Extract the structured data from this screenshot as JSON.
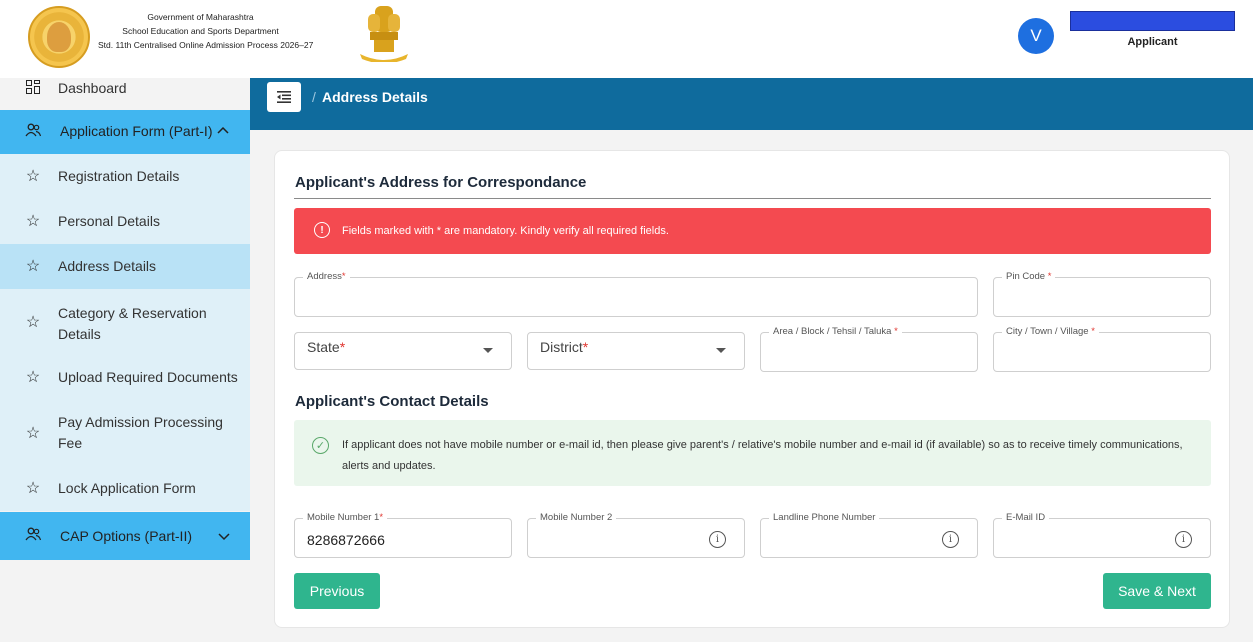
{
  "header": {
    "gov_line1": "Government of Maharashtra",
    "gov_line2": "School Education and Sports Department",
    "gov_line3": "Std. 11th Centralised Online Admission Process 2026–27",
    "avatar_letter": "V",
    "role": "Applicant"
  },
  "breadcrumb": {
    "separator": "/",
    "current": "Address Details"
  },
  "sidebar": {
    "dashboard": "Dashboard",
    "section1": "Application Form (Part-I)",
    "items": [
      "Registration Details",
      "Personal Details",
      "Address Details",
      "Category & Reservation Details",
      "Upload Required Documents",
      "Pay Admission Processing Fee",
      "Lock Application Form"
    ],
    "section2": "CAP Options (Part-II)"
  },
  "form": {
    "address_title": "Applicant's Address for Correspondance",
    "alert": "Fields marked with * are mandatory. Kindly verify all required fields.",
    "address_label": "Address",
    "pincode_label": "Pin Code",
    "state_label": "State",
    "district_label": "District",
    "area_label": "Area / Block / Tehsil / Taluka",
    "city_label": "City / Town / Village",
    "contact_title": "Applicant's Contact Details",
    "contact_note": "If applicant does not have mobile number or e-mail id, then please give parent's / relative's mobile number and e-mail id (if available) so as to receive timely communications, alerts and updates.",
    "mobile1_label": "Mobile Number 1",
    "mobile1_value": "8286872666",
    "mobile2_label": "Mobile Number 2",
    "landline_label": "Landline Phone Number",
    "email_label": "E-Mail ID",
    "required_mark": "*",
    "prev_button": "Previous",
    "next_button": "Save & Next"
  },
  "colors": {
    "band": "#0f6b9d",
    "sidebar_section": "#41b6f0",
    "sidebar_active": "#b9e2f6",
    "alert_red": "#f44a50",
    "note_green": "#eaf6ec",
    "button": "#2fb58e",
    "avatar": "#1e6fe0"
  }
}
